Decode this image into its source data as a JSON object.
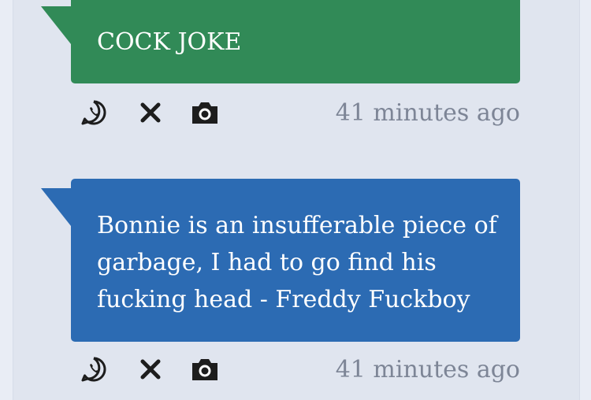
{
  "posts": [
    {
      "text": "COCK JOKE",
      "color": "#318a57",
      "time": "41 minutes ago",
      "actions": [
        "whatsapp-icon",
        "close-icon",
        "camera-icon"
      ]
    },
    {
      "text": "Bonnie is an insufferable piece of garbage, I had to go find his fucking head - Freddy Fuckboy",
      "color": "#2c6bb3",
      "time": "41 minutes ago",
      "actions": [
        "whatsapp-icon",
        "close-icon",
        "camera-icon"
      ]
    }
  ]
}
